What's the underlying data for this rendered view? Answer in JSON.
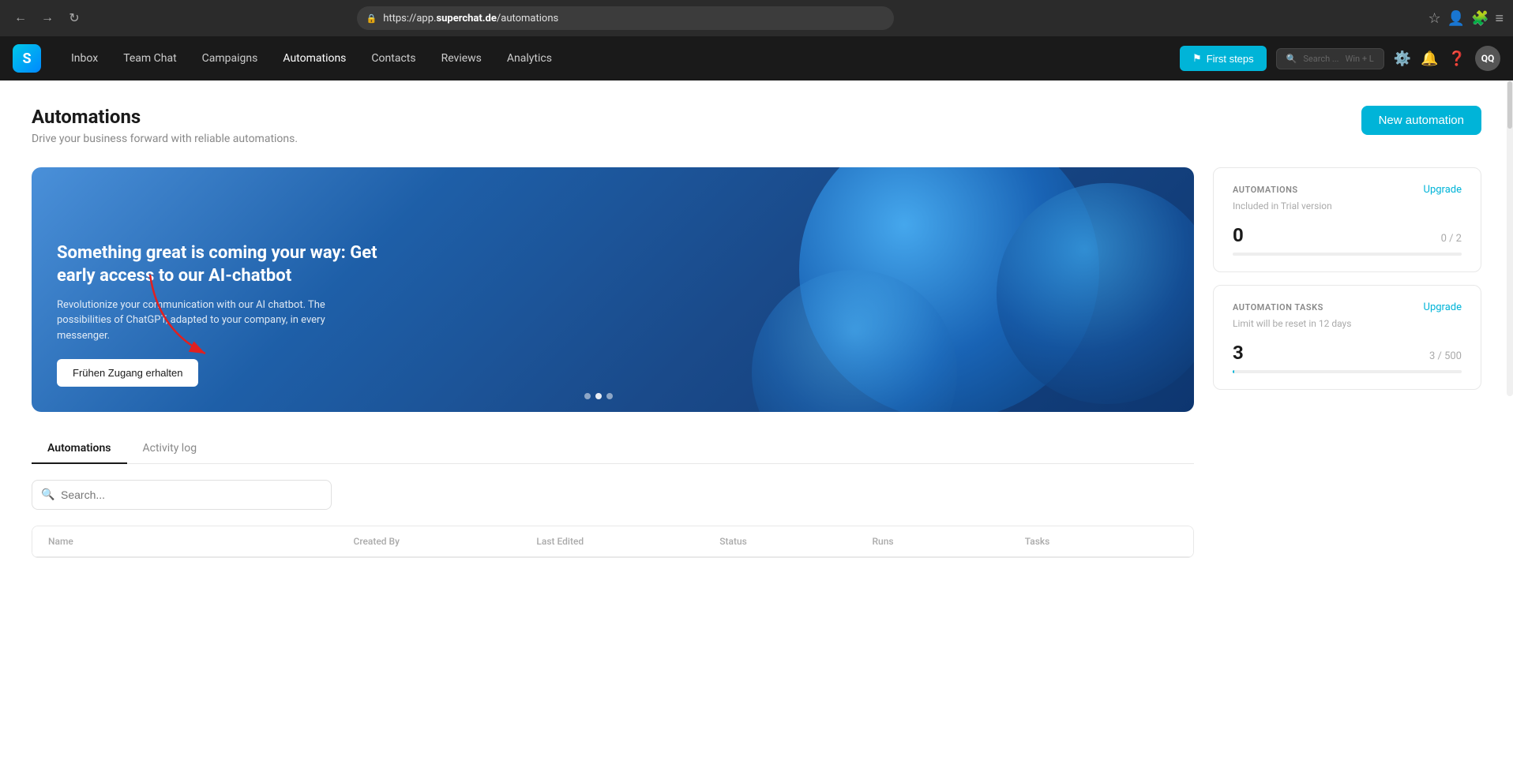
{
  "browser": {
    "url_prefix": "https://app.",
    "url_domain": "superchat.de",
    "url_path": "/automations",
    "back_btn": "←",
    "forward_btn": "→",
    "refresh_btn": "↻"
  },
  "navbar": {
    "logo_text": "S",
    "items": [
      {
        "label": "Inbox",
        "active": false
      },
      {
        "label": "Team Chat",
        "active": false
      },
      {
        "label": "Campaigns",
        "active": false
      },
      {
        "label": "Automations",
        "active": true
      },
      {
        "label": "Contacts",
        "active": false
      },
      {
        "label": "Reviews",
        "active": false
      },
      {
        "label": "Analytics",
        "active": false
      }
    ],
    "first_steps_label": "First steps",
    "search_placeholder": "Search ...",
    "search_shortcut": "Win + L",
    "avatar_initials": "QQ"
  },
  "page": {
    "title": "Automations",
    "subtitle": "Drive your business forward with reliable automations.",
    "new_automation_btn": "New automation"
  },
  "banner": {
    "title": "Something great is coming your way: Get early access to our AI-chatbot",
    "description": "Revolutionize your communication with our AI chatbot. The possibilities of ChatGPT, adapted to your company, in every messenger.",
    "cta_label": "Frühen Zugang erhalten",
    "dots": [
      {
        "active": false
      },
      {
        "active": true
      },
      {
        "active": false
      }
    ]
  },
  "sidebar_cards": [
    {
      "title": "AUTOMATIONS",
      "upgrade_label": "Upgrade",
      "subtitle": "Included in Trial version",
      "current": "0",
      "max": "0 / 2",
      "progress_pct": 0,
      "is_active": false
    },
    {
      "title": "AUTOMATION TASKS",
      "upgrade_label": "Upgrade",
      "subtitle": "Limit will be reset in 12 days",
      "current": "3",
      "max": "3 / 500",
      "progress_pct": 0.6,
      "is_active": true
    }
  ],
  "tabs": [
    {
      "label": "Automations",
      "active": true
    },
    {
      "label": "Activity log",
      "active": false
    }
  ],
  "search": {
    "placeholder": "Search..."
  },
  "table": {
    "columns": [
      "Name",
      "Created by",
      "Last edited",
      "Status",
      "Runs",
      "Tasks"
    ]
  }
}
